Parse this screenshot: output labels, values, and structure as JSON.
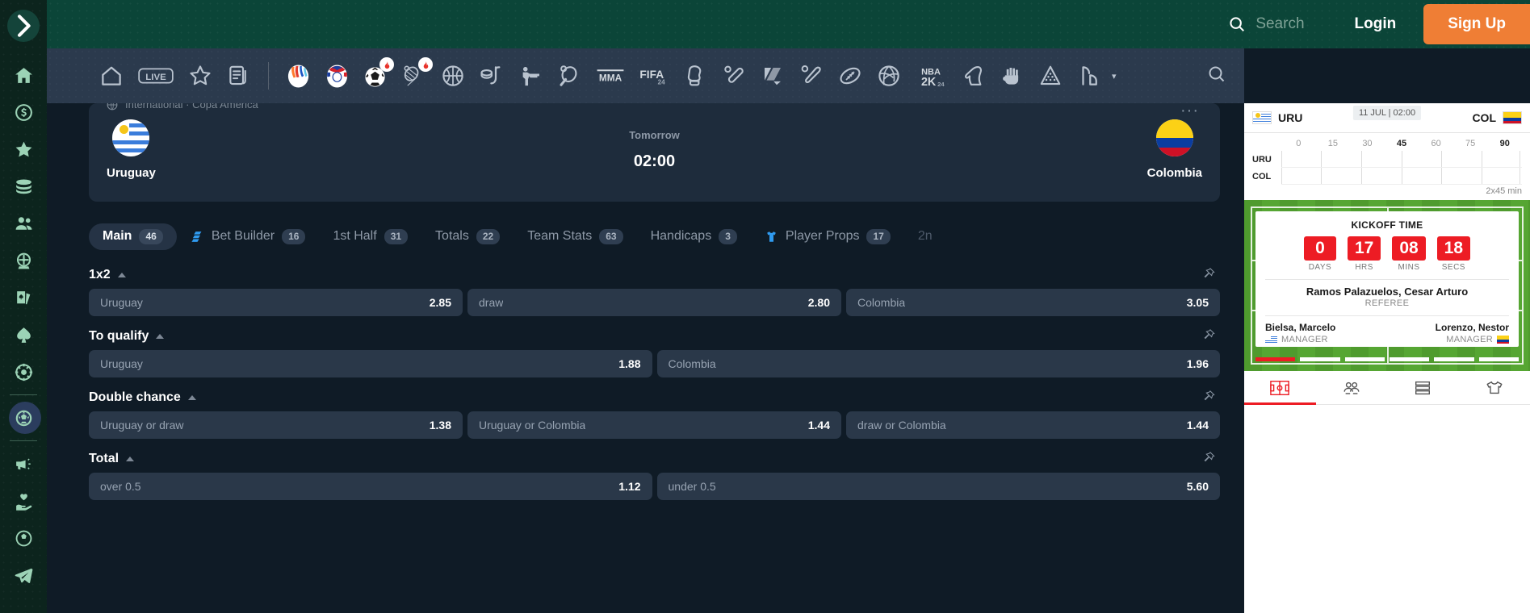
{
  "rail": {
    "toggle": "expand-sidebar",
    "items": [
      {
        "name": "home",
        "label": "Home"
      },
      {
        "name": "promotions-dollar",
        "label": "Promotions"
      },
      {
        "name": "favorites-star",
        "label": "Favorites"
      },
      {
        "name": "coins",
        "label": "Coins"
      },
      {
        "name": "friends",
        "label": "Friends"
      },
      {
        "name": "roulette-wheel",
        "label": "Roulette"
      },
      {
        "name": "cards",
        "label": "Cards"
      },
      {
        "name": "spade",
        "label": "Poker"
      },
      {
        "name": "casino-chip",
        "label": "Casino"
      },
      {
        "name": "sports-football",
        "label": "Sports"
      },
      {
        "name": "megaphone",
        "label": "News"
      },
      {
        "name": "responsible-gaming-heart",
        "label": "Responsible Gaming"
      },
      {
        "name": "soccer-ball",
        "label": "Soccer"
      },
      {
        "name": "telegram",
        "label": "Telegram"
      }
    ]
  },
  "header": {
    "search_placeholder": "Search",
    "login_label": "Login",
    "signup_label": "Sign Up"
  },
  "sportsbar": {
    "icons": [
      {
        "name": "home-icon",
        "label": ""
      },
      {
        "name": "live-icon",
        "label": "LIVE"
      },
      {
        "name": "star-icon",
        "label": ""
      },
      {
        "name": "bet-slip-icon",
        "label": ""
      },
      {
        "name": "euro-cup-icon",
        "label": ""
      },
      {
        "name": "copa-america-icon",
        "label": ""
      },
      {
        "name": "soccer-icon",
        "label": "",
        "hot": true
      },
      {
        "name": "tennis-icon",
        "label": "",
        "hot": true
      },
      {
        "name": "basketball-icon",
        "label": ""
      },
      {
        "name": "ice-hockey-icon",
        "label": ""
      },
      {
        "name": "esports-shooter-icon",
        "label": ""
      },
      {
        "name": "table-tennis-icon",
        "label": ""
      },
      {
        "name": "mma-icon",
        "label": "MMA"
      },
      {
        "name": "fifa24-icon",
        "label": "FIFA"
      },
      {
        "name": "boxing-icon",
        "label": ""
      },
      {
        "name": "cricket-icon",
        "label": ""
      },
      {
        "name": "dota-icon",
        "label": ""
      },
      {
        "name": "baseball-icon",
        "label": ""
      },
      {
        "name": "american-football-icon",
        "label": ""
      },
      {
        "name": "volleyball-icon",
        "label": ""
      },
      {
        "name": "nba2k-icon",
        "label": "NBA"
      },
      {
        "name": "horse-racing-icon",
        "label": ""
      },
      {
        "name": "handball-icon",
        "label": ""
      },
      {
        "name": "darts-icon",
        "label": ""
      },
      {
        "name": "snooker-icon",
        "label": ""
      }
    ],
    "more_caret": "▾",
    "search_icon": "search-icon"
  },
  "match": {
    "league": "International · Copa America",
    "home_team": "Uruguay",
    "away_team": "Colombia",
    "when": "Tomorrow",
    "time": "02:00",
    "more": "···"
  },
  "tabs": [
    {
      "label": "Main",
      "count": "46",
      "active": true,
      "icon": ""
    },
    {
      "label": "Bet Builder",
      "count": "16",
      "active": false,
      "icon": "bet-builder-icon"
    },
    {
      "label": "1st Half",
      "count": "31",
      "active": false,
      "icon": ""
    },
    {
      "label": "Totals",
      "count": "22",
      "active": false,
      "icon": ""
    },
    {
      "label": "Team Stats",
      "count": "63",
      "active": false,
      "icon": ""
    },
    {
      "label": "Handicaps",
      "count": "3",
      "active": false,
      "icon": ""
    },
    {
      "label": "Player Props",
      "count": "17",
      "active": false,
      "icon": "player-props-icon"
    },
    {
      "label": "2n",
      "count": "",
      "active": false,
      "icon": "",
      "faded": true
    }
  ],
  "markets": [
    {
      "title": "1x2",
      "collapsed": false,
      "odds": [
        {
          "name": "Uruguay",
          "value": "2.85"
        },
        {
          "name": "draw",
          "value": "2.80"
        },
        {
          "name": "Colombia",
          "value": "3.05"
        }
      ]
    },
    {
      "title": "To qualify",
      "collapsed": false,
      "odds": [
        {
          "name": "Uruguay",
          "value": "1.88"
        },
        {
          "name": "Colombia",
          "value": "1.96"
        }
      ]
    },
    {
      "title": "Double chance",
      "collapsed": false,
      "odds": [
        {
          "name": "Uruguay or draw",
          "value": "1.38"
        },
        {
          "name": "Uruguay or Colombia",
          "value": "1.44"
        },
        {
          "name": "draw or Colombia",
          "value": "1.44"
        }
      ]
    },
    {
      "title": "Total",
      "collapsed": false,
      "odds": [
        {
          "name": "over 0.5",
          "value": "1.12"
        },
        {
          "name": "under 0.5",
          "value": "5.60"
        }
      ]
    }
  ],
  "widget": {
    "home_code": "URU",
    "away_code": "COL",
    "datetime_badge": "11 JUL | 02:00",
    "timeline": {
      "ticks": [
        "0",
        "15",
        "30",
        "45",
        "60",
        "75",
        "90"
      ],
      "key_ticks": [
        "45",
        "90"
      ],
      "rows": [
        "URU",
        "COL"
      ],
      "duration": "2x45 min"
    },
    "kickoff": {
      "title": "KICKOFF TIME",
      "units": [
        {
          "value": "0",
          "unit": "DAYS"
        },
        {
          "value": "17",
          "unit": "HRS"
        },
        {
          "value": "08",
          "unit": "MINS"
        },
        {
          "value": "18",
          "unit": "SECS"
        }
      ]
    },
    "referee": {
      "name": "Ramos Palazuelos, Cesar Arturo",
      "role": "REFEREE"
    },
    "managers": [
      {
        "name": "Bielsa, Marcelo",
        "role": "MANAGER",
        "flag": "uru"
      },
      {
        "name": "Lorenzo, Nestor",
        "role": "MANAGER",
        "flag": "col"
      }
    ],
    "tabs": [
      {
        "name": "pitch-icon",
        "active": true
      },
      {
        "name": "lineup-icon",
        "active": false
      },
      {
        "name": "stats-list-icon",
        "active": false
      },
      {
        "name": "jersey-icon",
        "active": false
      }
    ]
  },
  "colors": {
    "brand_green": "#0b4538",
    "rail_green": "#0c241d",
    "accent_orange": "#ef7e35",
    "accent_blue": "#2f9bf0",
    "red": "#ed1c24",
    "page_bg": "#0f1b26"
  }
}
